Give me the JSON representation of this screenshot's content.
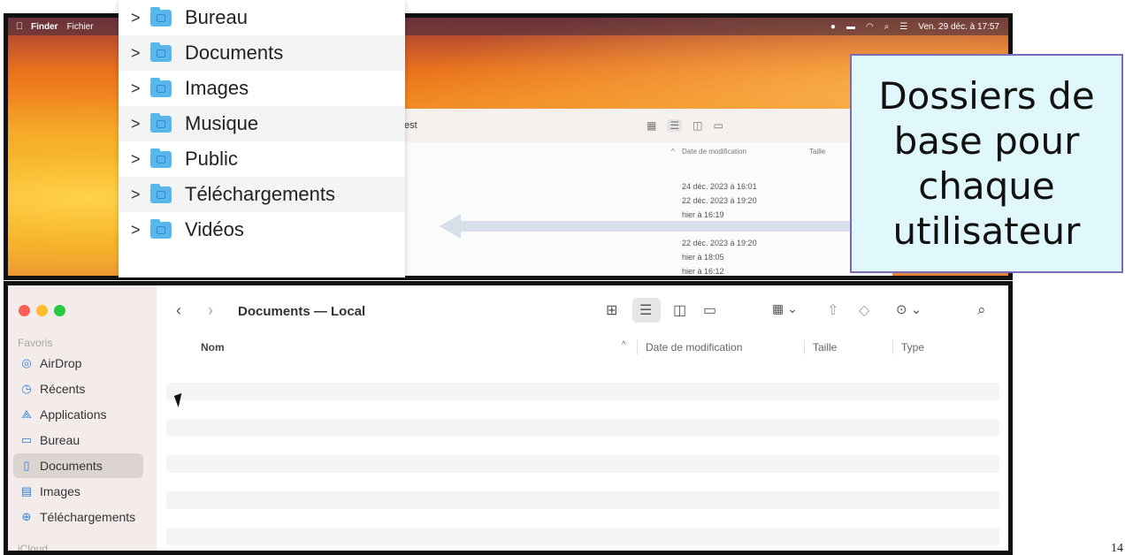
{
  "menubar": {
    "app_name": "Finder",
    "menu_item": "Fichier",
    "clock": "Ven. 29 déc. à 17:57"
  },
  "top_finder": {
    "title_fragment": "est",
    "col_date": "Date de modification",
    "col_size": "Taille",
    "dates": [
      "24 déc. 2023 à 16:01",
      "22 déc. 2023 à 19:20",
      "hier à 16:19",
      "22 déc. 2023 à 19:20",
      "hier à 18:05",
      "hier à 16:12"
    ]
  },
  "folder_list": [
    {
      "label": "Bureau",
      "icon": "desktop-folder-icon"
    },
    {
      "label": "Documents",
      "icon": "documents-folder-icon"
    },
    {
      "label": "Images",
      "icon": "pictures-folder-icon"
    },
    {
      "label": "Musique",
      "icon": "music-folder-icon"
    },
    {
      "label": "Public",
      "icon": "public-folder-icon"
    },
    {
      "label": "Téléchargements",
      "icon": "downloads-folder-icon"
    },
    {
      "label": "Vidéos",
      "icon": "movies-folder-icon"
    }
  ],
  "callout": {
    "text": "Dossiers de\nbase pour\nchaque\nutilisateur"
  },
  "finder": {
    "title": "Documents — Local",
    "sidebar": {
      "favorites_header": "Favoris",
      "items": [
        {
          "label": "AirDrop",
          "icon": "airdrop-icon"
        },
        {
          "label": "Récents",
          "icon": "clock-icon"
        },
        {
          "label": "Applications",
          "icon": "applications-icon"
        },
        {
          "label": "Bureau",
          "icon": "desktop-icon"
        },
        {
          "label": "Documents",
          "icon": "document-icon"
        },
        {
          "label": "Images",
          "icon": "image-icon"
        },
        {
          "label": "Téléchargements",
          "icon": "download-icon"
        }
      ],
      "icloud_header": "iCloud"
    },
    "columns": {
      "name": "Nom",
      "date": "Date de modification",
      "size": "Taille",
      "type": "Type"
    }
  },
  "page_number": "14"
}
